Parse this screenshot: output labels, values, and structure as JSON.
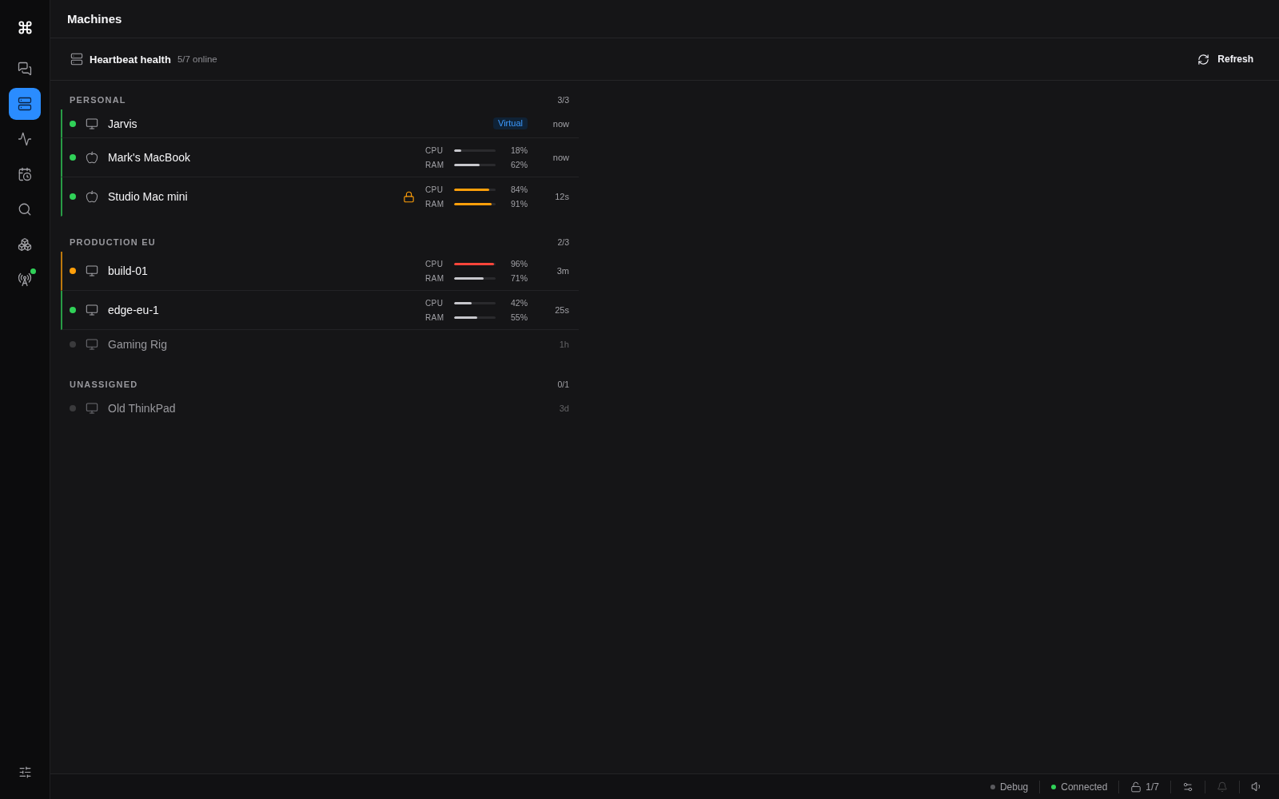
{
  "sidebar": {
    "items": [
      {
        "selected": false,
        "dot": false
      },
      {
        "selected": true,
        "dot": false
      },
      {
        "selected": false,
        "dot": false
      },
      {
        "selected": false,
        "dot": false
      },
      {
        "selected": false,
        "dot": false
      },
      {
        "selected": false,
        "dot": false
      },
      {
        "selected": false,
        "dot": true
      }
    ]
  },
  "header": {
    "title": "Machines"
  },
  "panel": {
    "title": "Heartbeat health",
    "summary": "5/7 online",
    "refresh_button": "Refresh"
  },
  "groups": [
    {
      "name": "PERSONAL",
      "count": "3/3",
      "machines": [
        {
          "name": "Jarvis",
          "kind": "monitor",
          "color": "#30d158",
          "online": true,
          "badge": "Virtual",
          "locked": false,
          "last_seen": "now"
        },
        {
          "name": "Mark's MacBook",
          "kind": "apple",
          "color": "#30d158",
          "online": true,
          "locked": false,
          "metrics": [
            {
              "label": "CPU",
              "level": 0.18,
              "reading": "18%"
            },
            {
              "label": "RAM",
              "level": 0.62,
              "reading": "62%"
            }
          ],
          "last_seen": "now"
        },
        {
          "name": "Studio Mac mini",
          "kind": "apple",
          "color": "#30d158",
          "online": true,
          "locked": true,
          "metrics": [
            {
              "label": "CPU",
              "level": 0.84,
              "reading": "84%"
            },
            {
              "label": "RAM",
              "level": 0.91,
              "reading": "91%"
            }
          ],
          "last_seen": "12s"
        }
      ]
    },
    {
      "name": "PRODUCTION EU",
      "count": "2/3",
      "machines": [
        {
          "name": "build-01",
          "kind": "monitor",
          "color": "#ff9f0a",
          "online": true,
          "locked": false,
          "metrics": [
            {
              "label": "CPU",
              "level": 0.96,
              "reading": "96%"
            },
            {
              "label": "RAM",
              "level": 0.71,
              "reading": "71%"
            }
          ],
          "last_seen": "3m"
        },
        {
          "name": "edge-eu-1",
          "kind": "monitor",
          "color": "#30d158",
          "online": true,
          "locked": false,
          "metrics": [
            {
              "label": "CPU",
              "level": 0.42,
              "reading": "42%"
            },
            {
              "label": "RAM",
              "level": 0.55,
              "reading": "55%"
            }
          ],
          "last_seen": "25s"
        },
        {
          "name": "Gaming Rig",
          "kind": "monitor",
          "color": "#3a3a3c",
          "online": false,
          "locked": false,
          "last_seen": "1h"
        }
      ]
    },
    {
      "name": "UNASSIGNED",
      "count": "0/1",
      "machines": [
        {
          "name": "Old ThinkPad",
          "kind": "monitor",
          "color": "#3a3a3c",
          "online": false,
          "locked": false,
          "last_seen": "3d"
        }
      ]
    }
  ],
  "status_bar": {
    "indicators": [
      {
        "label": "Debug",
        "on": false
      },
      {
        "label": "Connected",
        "on": true
      }
    ],
    "lock_count": "1/7",
    "notifications_enabled": false
  }
}
